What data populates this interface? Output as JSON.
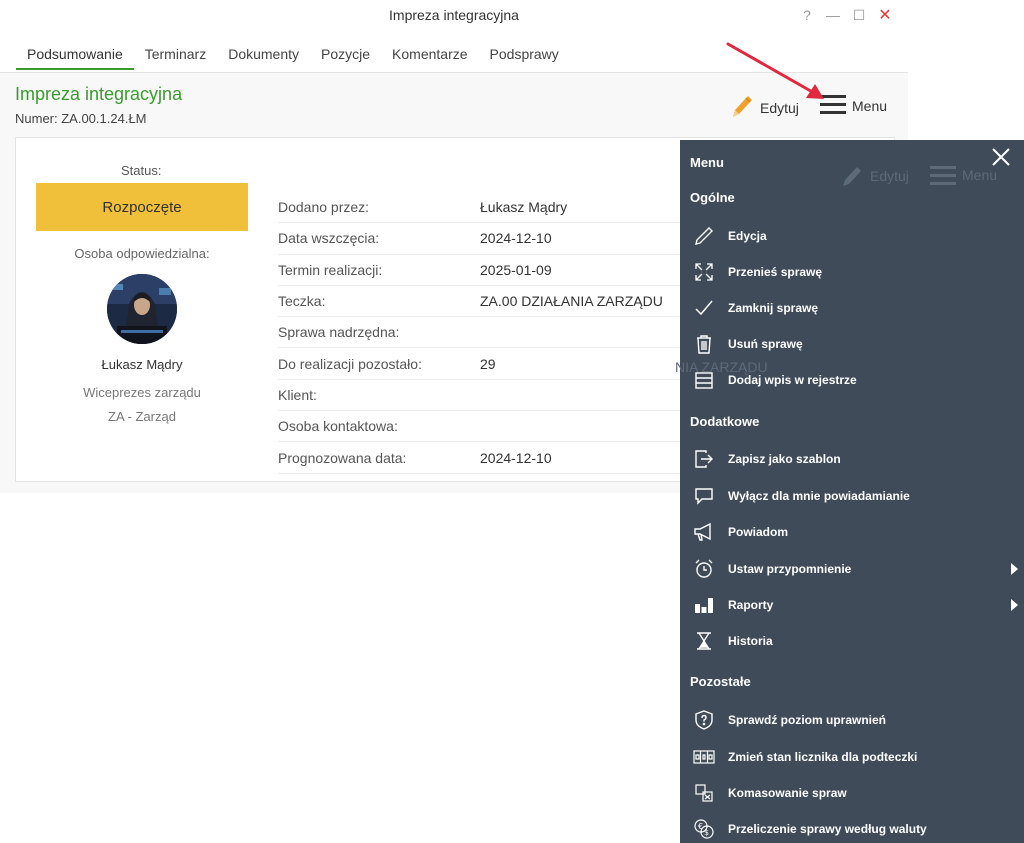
{
  "window": {
    "title": "Impreza integracyjna",
    "controls": {
      "help": "?",
      "minimize": "—",
      "maximize": "☐",
      "close": "✕"
    }
  },
  "tabs": [
    {
      "label": "Podsumowanie",
      "active": true
    },
    {
      "label": "Terminarz"
    },
    {
      "label": "Dokumenty"
    },
    {
      "label": "Pozycje"
    },
    {
      "label": "Komentarze"
    },
    {
      "label": "Podsprawy"
    }
  ],
  "header": {
    "title": "Impreza integracyjna",
    "number": "Numer: ZA.00.1.24.ŁM",
    "edit_label": "Edytuj",
    "menu_label": "Menu"
  },
  "summary": {
    "status_label": "Status:",
    "status_value": "Rozpoczęte",
    "responsible_label": "Osoba odpowiedzialna:",
    "person_name": "Łukasz Mądry",
    "person_role": "Wiceprezes zarządu",
    "person_dept": "ZA - Zarząd"
  },
  "fields": [
    {
      "label": "Dodano przez:",
      "value": "Łukasz Mądry"
    },
    {
      "label": "Data wszczęcia:",
      "value": "2024-12-10"
    },
    {
      "label": "Termin realizacji:",
      "value": "2025-01-09"
    },
    {
      "label": "Teczka:",
      "value": "ZA.00 DZIAŁANIA ZARZĄDU"
    },
    {
      "label": "Sprawa nadrzędna:",
      "value": ""
    },
    {
      "label": "Do realizacji pozostało:",
      "value": "29"
    },
    {
      "label": "Klient:",
      "value": ""
    },
    {
      "label": "Osoba kontaktowa:",
      "value": ""
    },
    {
      "label": "Prognozowana data:",
      "value": "2024-12-10"
    }
  ],
  "side_menu": {
    "title": "Menu",
    "ghost_edit": "Edytuj",
    "ghost_menu": "Menu",
    "ghost_overlay": "NIA ZARZĄDU",
    "sections": [
      {
        "title": "Ogólne",
        "items": [
          {
            "label": "Edycja",
            "icon": "pencil-icon"
          },
          {
            "label": "Przenieś sprawę",
            "icon": "move-arrows-icon"
          },
          {
            "label": "Zamknij sprawę",
            "icon": "checkmark-icon"
          },
          {
            "label": "Usuń sprawę",
            "icon": "trash-icon"
          },
          {
            "label": "Dodaj wpis w rejestrze",
            "icon": "register-icon"
          }
        ]
      },
      {
        "title": "Dodatkowe",
        "items": [
          {
            "label": "Zapisz jako szablon",
            "icon": "export-icon"
          },
          {
            "label": "Wyłącz dla mnie powiadamianie",
            "icon": "speech-bubble-icon"
          },
          {
            "label": "Powiadom",
            "icon": "megaphone-icon"
          },
          {
            "label": "Ustaw przypomnienie",
            "icon": "alarm-clock-icon",
            "submenu": true
          },
          {
            "label": "Raporty",
            "icon": "bar-chart-icon",
            "submenu": true
          },
          {
            "label": "Historia",
            "icon": "hourglass-icon"
          }
        ]
      },
      {
        "title": "Pozostałe",
        "items": [
          {
            "label": "Sprawdź poziom uprawnień",
            "icon": "shield-question-icon"
          },
          {
            "label": "Zmień stan licznika dla podteczki",
            "icon": "counter-icon"
          },
          {
            "label": "Komasowanie spraw",
            "icon": "merge-icon"
          },
          {
            "label": "Przeliczenie sprawy według waluty",
            "icon": "currency-exchange-icon"
          }
        ]
      }
    ]
  },
  "colors": {
    "accent_green": "#3a9b2e",
    "status_yellow": "#f0c03a",
    "menu_panel": "#3f4b59",
    "annotation_red": "#e0283f"
  }
}
